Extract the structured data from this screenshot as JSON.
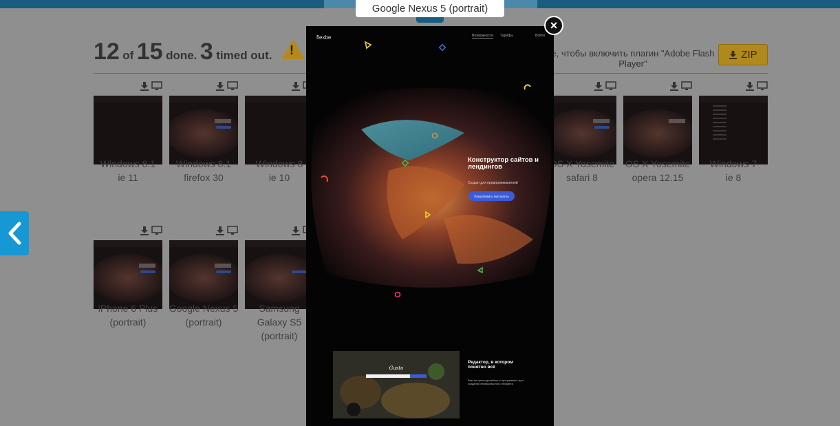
{
  "summary": {
    "done_count": "12",
    "of": "of",
    "total": "15",
    "done": "done.",
    "timed_out_count": "3",
    "timed_out": "timed out."
  },
  "flash_message": "е, чтобы включить плагин \"Adobe Flash Player\"",
  "zip_label": "ZIP",
  "screenshots": [
    {
      "caption": [
        "Windows 8.1",
        "ie 11"
      ]
    },
    {
      "caption": [
        "Windows 8.1",
        "firefox 30"
      ]
    },
    {
      "caption": [
        "Windows 8",
        "ie 10"
      ]
    },
    {
      "caption": [
        "OS X Yosemite",
        "safari 8"
      ]
    },
    {
      "caption": [
        "OS X Yosemite",
        "opera 12.15"
      ]
    },
    {
      "caption": [
        "Windows 7",
        "ie 8"
      ]
    },
    {
      "caption": [
        "iPhone 6 Plus",
        "(portrait)"
      ]
    },
    {
      "caption": [
        "Google Nexus 5",
        "(portrait)"
      ]
    },
    {
      "caption": [
        "Samsung",
        "Galaxy S5",
        "(portrait)"
      ]
    }
  ],
  "modal": {
    "device_label": "Google Nexus 5 (portrait)",
    "close_symbol": "×",
    "brand": "flexbe",
    "nav_links": [
      "Возможности",
      "Тарифы",
      "Войти"
    ],
    "hero_title": "Конструктор сайтов и лендингов",
    "hero_subtitle": "Создан для предпринимателей",
    "hero_button": "Попробовать бесплатно",
    "section_title": "Редактор, в котором понятно всё",
    "section_text": "Вам не нужен дизайнер и программист для создания первоклассного лендинга",
    "section_image_text": "Gusto"
  },
  "colors": {
    "accent_blue": "#1598d4",
    "zip_gold": "#b0891c",
    "hero_button": "#3b5bd8"
  }
}
